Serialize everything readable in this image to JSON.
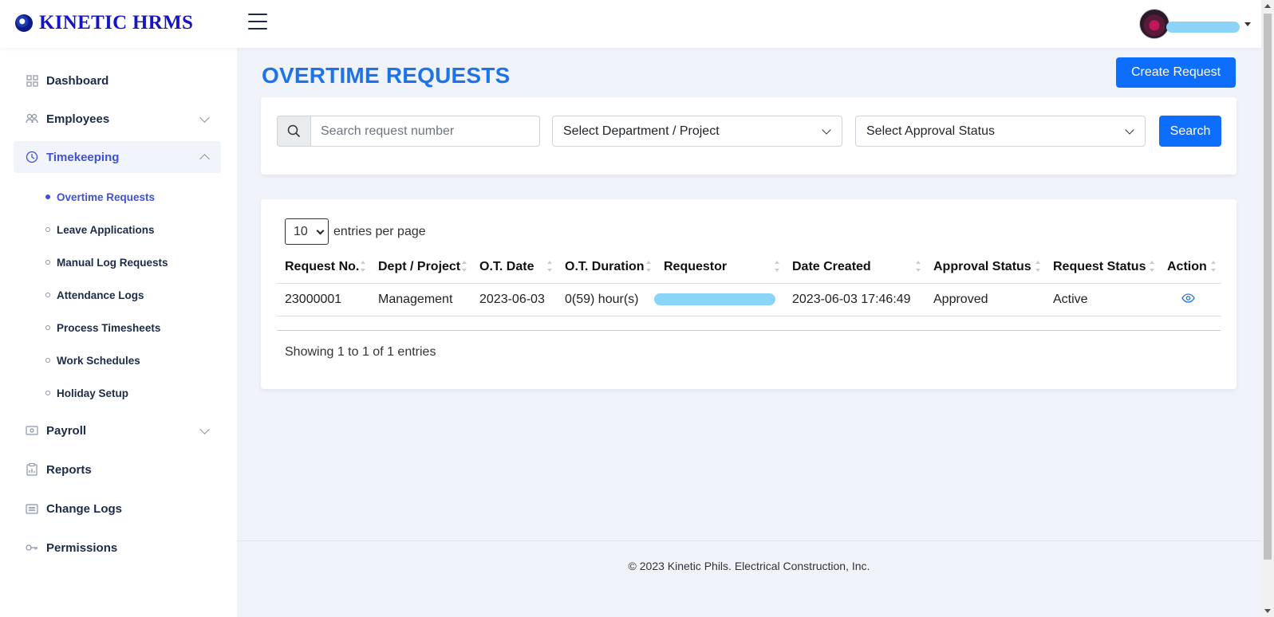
{
  "app": {
    "logo_text": "KINETIC HRMS"
  },
  "sidebar": {
    "items": [
      {
        "label": "Dashboard",
        "icon": "grid-icon"
      },
      {
        "label": "Employees",
        "icon": "users-icon"
      },
      {
        "label": "Timekeeping",
        "icon": "clock-icon",
        "active": true
      },
      {
        "label": "Payroll",
        "icon": "money-icon"
      },
      {
        "label": "Reports",
        "icon": "clipboard-chart-icon"
      },
      {
        "label": "Change Logs",
        "icon": "list-icon"
      },
      {
        "label": "Permissions",
        "icon": "key-icon"
      }
    ],
    "timekeeping_sub": [
      {
        "label": "Overtime Requests",
        "active": true
      },
      {
        "label": "Leave Applications"
      },
      {
        "label": "Manual Log Requests"
      },
      {
        "label": "Attendance Logs"
      },
      {
        "label": "Process Timesheets"
      },
      {
        "label": "Work Schedules"
      },
      {
        "label": "Holiday Setup"
      }
    ]
  },
  "page": {
    "title": "OVERTIME REQUESTS",
    "create_button": "Create Request"
  },
  "filters": {
    "search_placeholder": "Search request number",
    "department_select": "Select Department / Project",
    "status_select": "Select Approval Status",
    "search_button": "Search"
  },
  "table": {
    "entries_per_page_value": "10",
    "entries_per_page_label": "entries per page",
    "headers": [
      "Request No.",
      "Dept / Project",
      "O.T. Date",
      "O.T. Duration",
      "Requestor",
      "Date Created",
      "Approval Status",
      "Request Status",
      "Action"
    ],
    "rows": [
      {
        "request_no": "23000001",
        "dept": "Management",
        "ot_date": "2023-06-03",
        "ot_duration": "0(59) hour(s)",
        "requestor": "",
        "date_created": "2023-06-03 17:46:49",
        "approval_status": "Approved",
        "request_status": "Active",
        "action_icon": "eye-icon"
      }
    ],
    "showing_text": "Showing 1 to 1 of 1 entries"
  },
  "footer": {
    "text": "© 2023 Kinetic Phils. Electrical Construction, Inc."
  },
  "colors": {
    "accent": "#0d6efd",
    "title": "#1e73e8",
    "nav_active": "#3f51d6"
  }
}
